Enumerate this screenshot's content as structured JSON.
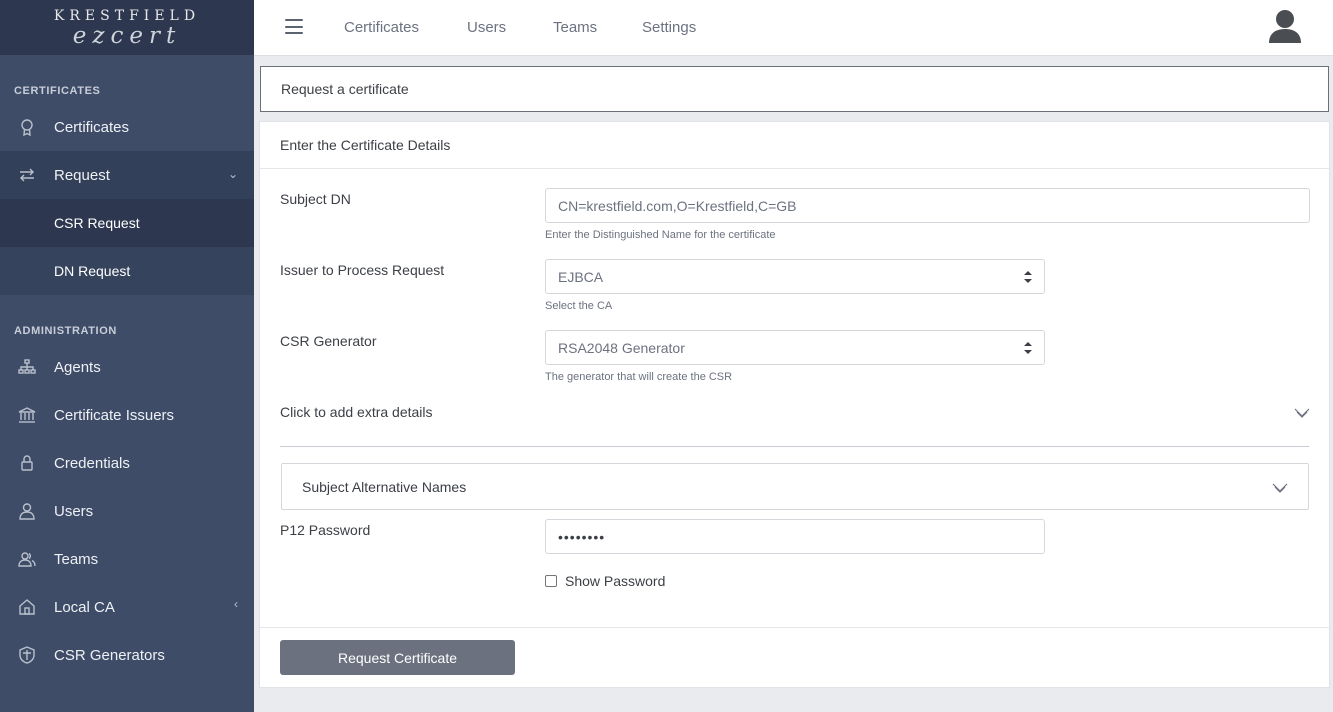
{
  "logo": {
    "line1": "KRESTFIELD",
    "line2": "ezcert"
  },
  "sidebar": {
    "section_certificates": "CERTIFICATES",
    "section_administration": "ADMINISTRATION",
    "items": {
      "certificates": "Certificates",
      "request": "Request",
      "csr_request": "CSR Request",
      "dn_request": "DN Request",
      "agents": "Agents",
      "certificate_issuers": "Certificate Issuers",
      "credentials": "Credentials",
      "users": "Users",
      "teams": "Teams",
      "local_ca": "Local CA",
      "csr_generators": "CSR Generators"
    }
  },
  "topnav": {
    "links": [
      "Certificates",
      "Users",
      "Teams",
      "Settings"
    ]
  },
  "page": {
    "title": "Request a certificate"
  },
  "form": {
    "header": "Enter the Certificate Details",
    "subject_dn": {
      "label": "Subject DN",
      "value": "CN=krestfield.com,O=Krestfield,C=GB",
      "help": "Enter the Distinguished Name for the certificate"
    },
    "issuer": {
      "label": "Issuer to Process Request",
      "value": "EJBCA",
      "help": "Select the CA"
    },
    "csr_generator": {
      "label": "CSR Generator",
      "value": "RSA2048 Generator",
      "help": "The generator that will create the CSR"
    },
    "extra_details": "Click to add extra details",
    "san": "Subject Alternative Names",
    "p12_password": {
      "label": "P12 Password",
      "value": "••••••••"
    },
    "show_password": "Show Password",
    "submit": "Request Certificate"
  },
  "colors": {
    "sidebar_bg": "#3e4c68",
    "sidebar_dark": "#2d3850",
    "button_bg": "#6b717f"
  }
}
